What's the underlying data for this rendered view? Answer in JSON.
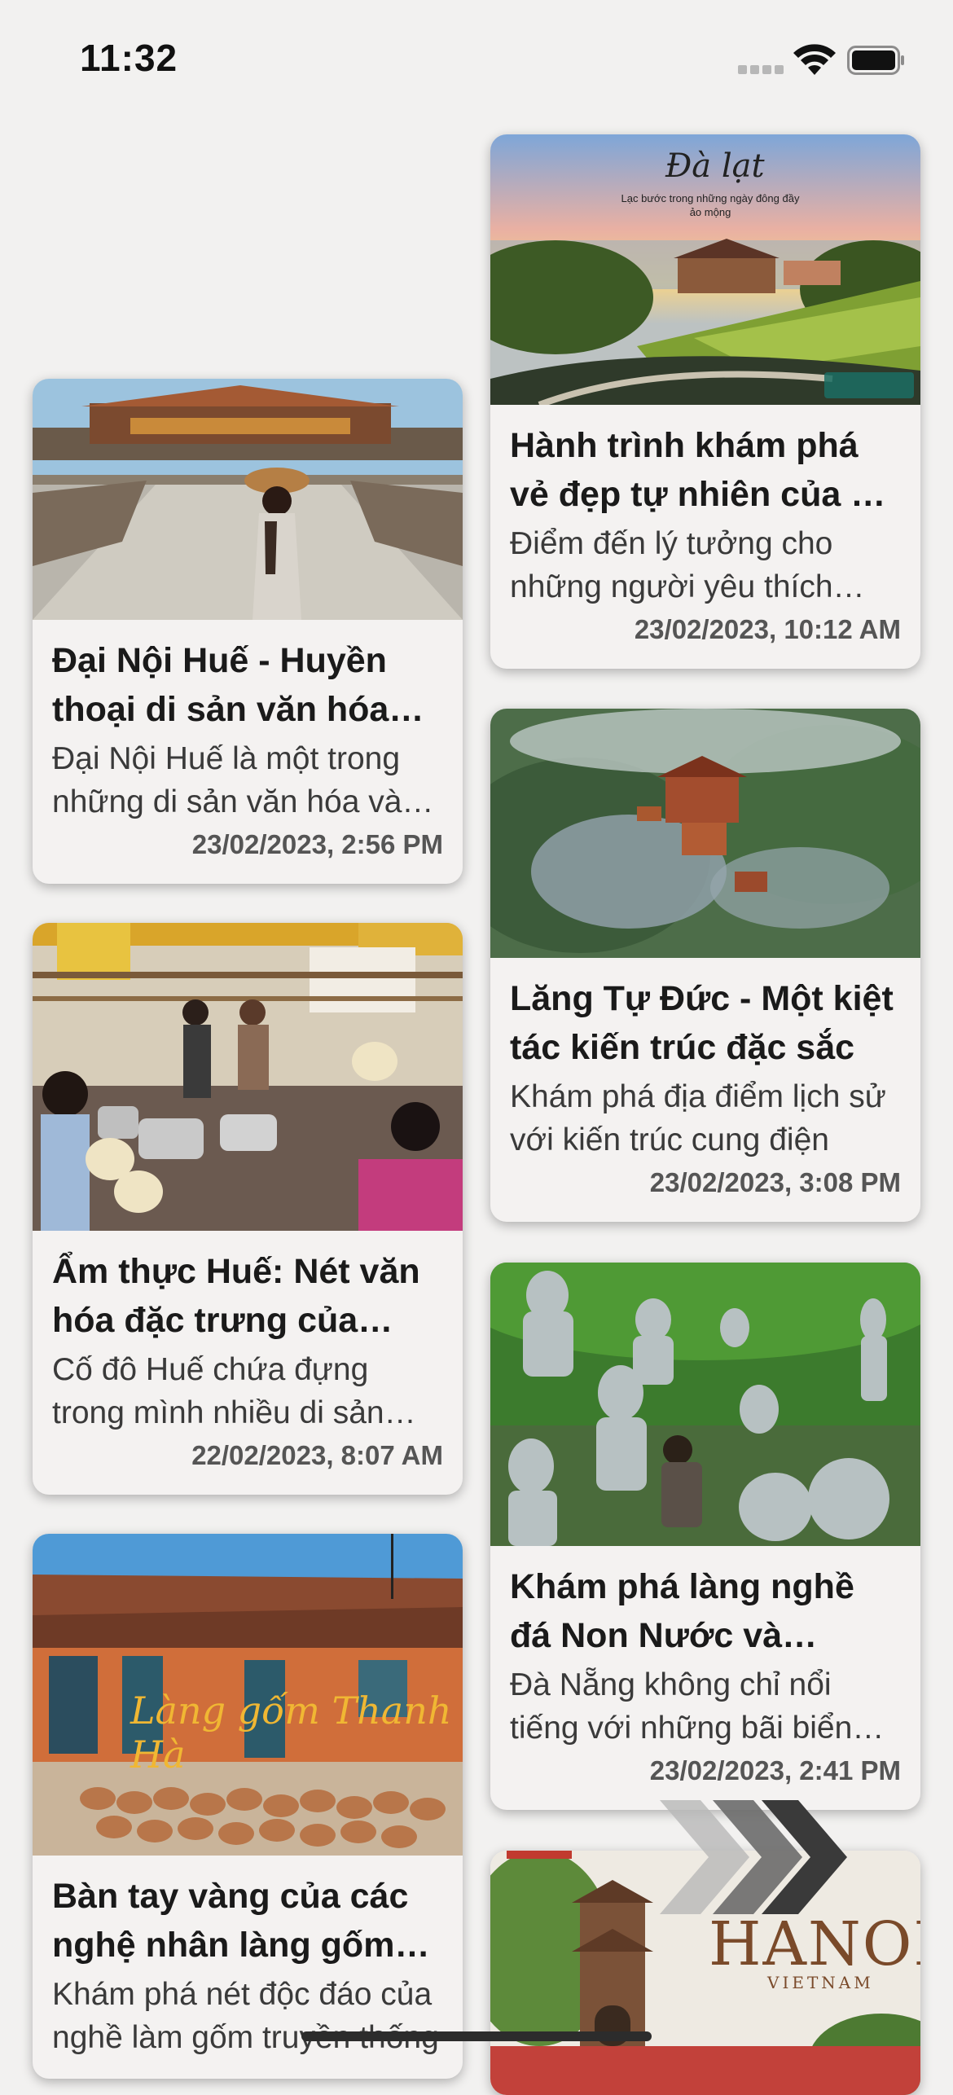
{
  "status_bar": {
    "time": "11:32"
  },
  "cards": [
    {
      "title": "Hành trình khám phá vẻ đẹp tự nhiên của Đà Lạt",
      "description": " Điểm đến lý tưởng cho những người yêu thích thiên nhiên",
      "date": "23/02/2023, 10:12 AM",
      "overlay_title": "Đà lạt",
      "overlay_subtitle": "Lạc bước trong những ngày đông đầy ảo mộng",
      "image_icon": "dalat-landscape-image"
    },
    {
      "title": "Đại Nội Huế - Huyền thoại di sản văn hóa Việt Nam",
      "description": "Đại Nội Huế là một trong những di sản văn hóa và lịch sử",
      "date": "23/02/2023, 2:56 PM",
      "image_icon": "hue-citadel-image"
    },
    {
      "title": "Lăng Tự Đức - Một kiệt tác kiến trúc đặc sắc",
      "description": "Khám phá địa điểm lịch sử với kiến trúc cung điện",
      "date": "23/02/2023, 3:08 PM",
      "image_icon": "tu-duc-tomb-image"
    },
    {
      "title": "Ẩm thực Huế: Nét văn hóa đặc trưng của vùng đất cố đô",
      "description": "Cố đô Huế chứa đựng trong mình nhiều di sản văn hóa",
      "date": "22/02/2023, 8:07 AM",
      "image_icon": "hue-food-stall-image"
    },
    {
      "title": "Khám phá làng nghề đá Non Nước và những tác phẩm",
      "description": "Đà Nẵng không chỉ nổi tiếng với những bãi biển đẹp",
      "date": "23/02/2023, 2:41 PM",
      "image_icon": "stone-statues-image"
    },
    {
      "title": "Bàn tay vàng của các nghệ nhân làng gốm Thanh Hà",
      "description": "Khám phá nét độc đáo của nghề làm gốm truyền thống",
      "date": "",
      "overlay_title": "Làng gốm Thanh Hà",
      "image_icon": "pottery-village-image"
    },
    {
      "title": "",
      "description": "",
      "date": "",
      "overlay_title": "HANOI",
      "overlay_subtitle": "VIETNAM",
      "image_icon": "hanoi-pagoda-image"
    }
  ],
  "colors": {
    "background": "#f2f1f0",
    "card": "#f4f2f1",
    "title": "#1a1a1a",
    "date": "#555555"
  },
  "icons": {
    "wifi": "wifi-icon",
    "battery": "battery-icon",
    "signal": "signal-dots-icon",
    "next": "triple-chevron-right-icon"
  }
}
